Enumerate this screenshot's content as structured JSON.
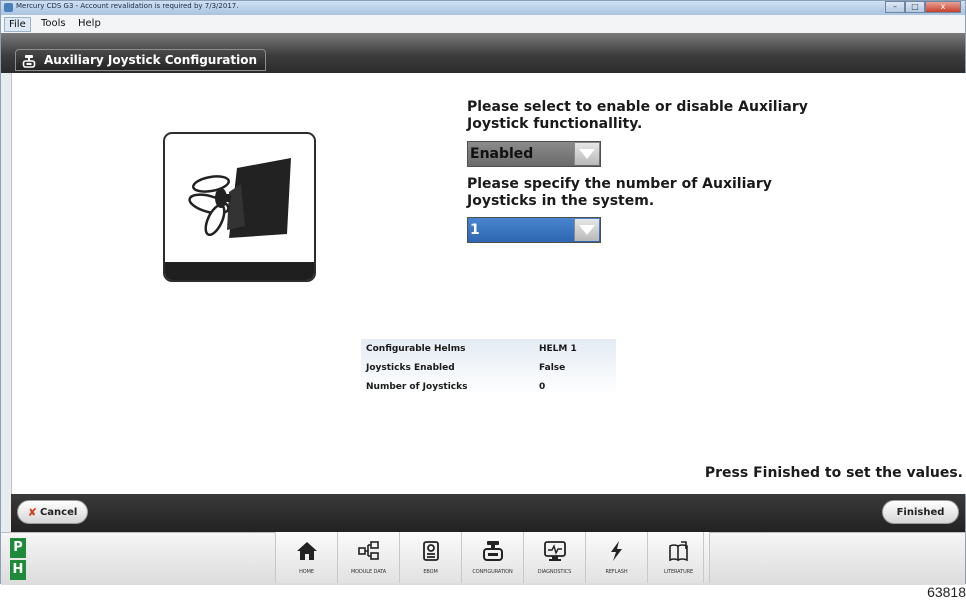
{
  "window": {
    "title": "Mercury CDS G3 - Account revalidation is required by 7/3/2017.",
    "minimize_icon": "minimize-icon",
    "maximize_icon": "maximize-icon",
    "close_glyph": "x"
  },
  "menu": {
    "file": "File",
    "tools": "Tools",
    "help": "Help"
  },
  "header": {
    "title": "Auxiliary Joystick Configuration",
    "icon": "joystick-config-icon"
  },
  "content": {
    "question_enable": [
      "Please select to enable or disable Auxiliary",
      "Joystick functionallity."
    ],
    "enable_select": {
      "value": "Enabled"
    },
    "question_count": [
      "Please specify the number of Auxiliary",
      "Joysticks in the system."
    ],
    "count_select": {
      "value": "1"
    },
    "status_table": [
      {
        "label": "Configurable Helms",
        "value": "HELM 1"
      },
      {
        "label": "Joysticks Enabled",
        "value": "False"
      },
      {
        "label": "Number of Joysticks",
        "value": "0"
      }
    ],
    "finish_note": "Press Finished to set the values."
  },
  "footer": {
    "cancel_label": "Cancel",
    "finish_label": "Finished"
  },
  "helm_indicators": {
    "p": "P",
    "h": "H"
  },
  "nav": [
    {
      "label": "HOME",
      "icon": "home-icon"
    },
    {
      "label": "MODULE DATA",
      "icon": "module-data-icon"
    },
    {
      "label": "EBOM",
      "icon": "ebom-icon"
    },
    {
      "label": "CONFIGURATION",
      "icon": "configuration-icon"
    },
    {
      "label": "DIAGNOSTICS",
      "icon": "diagnostics-icon"
    },
    {
      "label": "REFLASH",
      "icon": "reflash-icon"
    },
    {
      "label": "LITERATURE",
      "icon": "literature-icon"
    }
  ],
  "figure_number": "63818",
  "colors": {
    "helm_green": "#1f8a3a",
    "select_blue": "#2d66b1",
    "close_red": "#c8402b"
  }
}
